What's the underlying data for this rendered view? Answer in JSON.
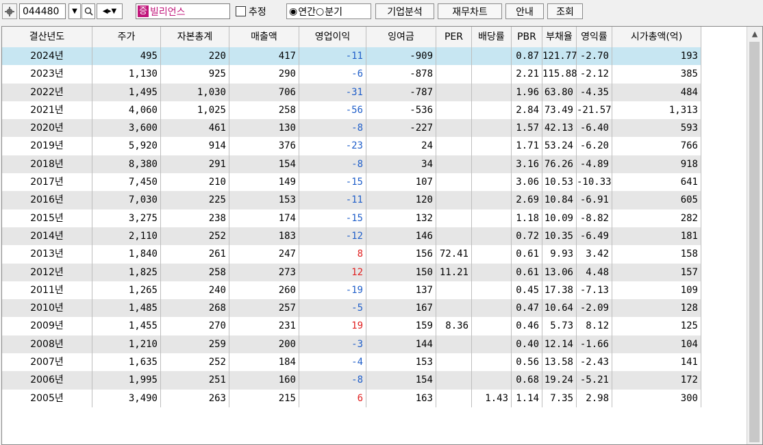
{
  "toolbar": {
    "stock_code": "044480",
    "dropdown_arrow": "▼",
    "search_icon": "⚲",
    "speaker_icon": "◀▸▼",
    "badge": "증",
    "company_name": "빌리언스",
    "estimate_label": "추정",
    "annual_label": "연간",
    "quarterly_label": "분기",
    "selected_period": "연간",
    "btn_company_analysis": "기업분석",
    "btn_financial_chart": "재무차트",
    "btn_guide": "안내",
    "btn_search": "조회"
  },
  "table": {
    "headers": [
      "결산년도",
      "주가",
      "자본총계",
      "매출액",
      "영업이익",
      "잉여금",
      "PER",
      "배당률",
      "PBR",
      "부채율",
      "영익률",
      "시가총액(억)"
    ],
    "rows": [
      [
        "2024년",
        "495",
        "220",
        "417",
        "-11",
        "-909",
        "",
        "",
        "0.87",
        "121.77",
        "-2.70",
        "193"
      ],
      [
        "2023년",
        "1,130",
        "925",
        "290",
        "-6",
        "-878",
        "",
        "",
        "2.21",
        "115.88",
        "-2.12",
        "385"
      ],
      [
        "2022년",
        "1,495",
        "1,030",
        "706",
        "-31",
        "-787",
        "",
        "",
        "1.96",
        "63.80",
        "-4.35",
        "484"
      ],
      [
        "2021년",
        "4,060",
        "1,025",
        "258",
        "-56",
        "-536",
        "",
        "",
        "2.84",
        "73.49",
        "-21.57",
        "1,313"
      ],
      [
        "2020년",
        "3,600",
        "461",
        "130",
        "-8",
        "-227",
        "",
        "",
        "1.57",
        "42.13",
        "-6.40",
        "593"
      ],
      [
        "2019년",
        "5,920",
        "914",
        "376",
        "-23",
        "24",
        "",
        "",
        "1.71",
        "53.24",
        "-6.20",
        "766"
      ],
      [
        "2018년",
        "8,380",
        "291",
        "154",
        "-8",
        "34",
        "",
        "",
        "3.16",
        "76.26",
        "-4.89",
        "918"
      ],
      [
        "2017년",
        "7,450",
        "210",
        "149",
        "-15",
        "107",
        "",
        "",
        "3.06",
        "10.53",
        "-10.33",
        "641"
      ],
      [
        "2016년",
        "7,030",
        "225",
        "153",
        "-11",
        "120",
        "",
        "",
        "2.69",
        "10.84",
        "-6.91",
        "605"
      ],
      [
        "2015년",
        "3,275",
        "238",
        "174",
        "-15",
        "132",
        "",
        "",
        "1.18",
        "10.09",
        "-8.82",
        "282"
      ],
      [
        "2014년",
        "2,110",
        "252",
        "183",
        "-12",
        "146",
        "",
        "",
        "0.72",
        "10.35",
        "-6.49",
        "181"
      ],
      [
        "2013년",
        "1,840",
        "261",
        "247",
        "8",
        "156",
        "72.41",
        "",
        "0.61",
        "9.93",
        "3.42",
        "158"
      ],
      [
        "2012년",
        "1,825",
        "258",
        "273",
        "12",
        "150",
        "11.21",
        "",
        "0.61",
        "13.06",
        "4.48",
        "157"
      ],
      [
        "2011년",
        "1,265",
        "240",
        "260",
        "-19",
        "137",
        "",
        "",
        "0.45",
        "17.38",
        "-7.13",
        "109"
      ],
      [
        "2010년",
        "1,485",
        "268",
        "257",
        "-5",
        "167",
        "",
        "",
        "0.47",
        "10.64",
        "-2.09",
        "128"
      ],
      [
        "2009년",
        "1,455",
        "270",
        "231",
        "19",
        "159",
        "8.36",
        "",
        "0.46",
        "5.73",
        "8.12",
        "125"
      ],
      [
        "2008년",
        "1,210",
        "259",
        "200",
        "-3",
        "144",
        "",
        "",
        "0.40",
        "12.14",
        "-1.66",
        "104"
      ],
      [
        "2007년",
        "1,635",
        "252",
        "184",
        "-4",
        "153",
        "",
        "",
        "0.56",
        "13.58",
        "-2.43",
        "141"
      ],
      [
        "2006년",
        "1,995",
        "251",
        "160",
        "-8",
        "154",
        "",
        "",
        "0.68",
        "19.24",
        "-5.21",
        "172"
      ],
      [
        "2005년",
        "3,490",
        "263",
        "215",
        "6",
        "163",
        "",
        "1.43",
        "1.14",
        "7.35",
        "2.98",
        "300"
      ]
    ],
    "selected_row": 0
  },
  "colors": {
    "negative": "#1f5ec9",
    "positive": "#e02020",
    "selected_row": "#c7e6f2",
    "alt_row": "#e6e6e6",
    "badge": "#c0157a"
  },
  "scrollbar": {
    "up_arrow": "▲"
  }
}
